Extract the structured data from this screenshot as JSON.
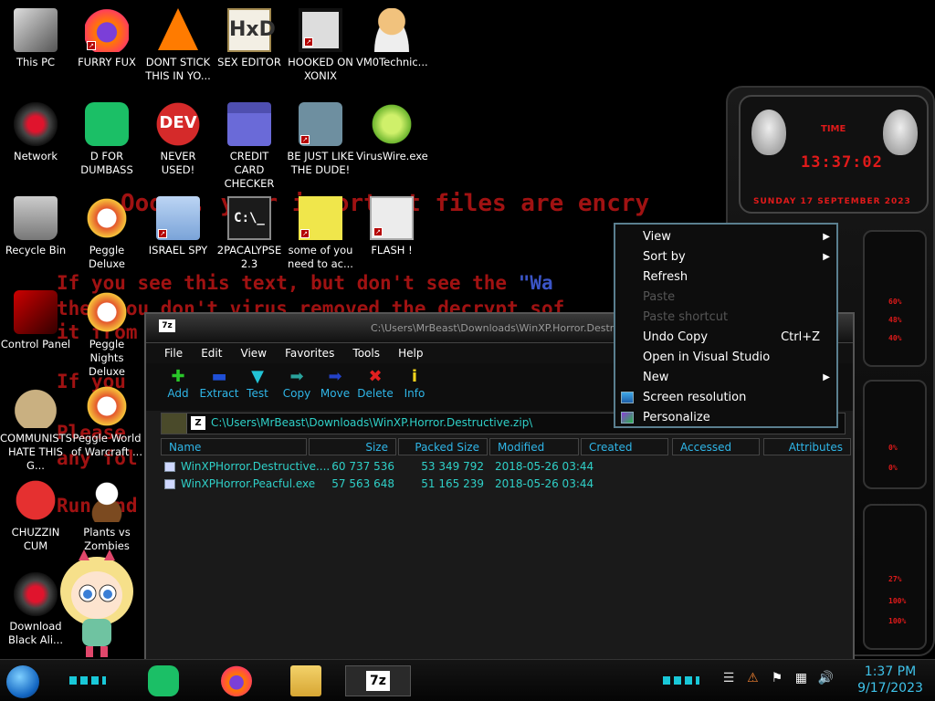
{
  "ransom_note": {
    "line1": "Ooops, your important files are encry",
    "line2a": "If you see this text, but don't see the ",
    "line2b": "\"Wa",
    "line3": "then you don't virus removed the decrypt sof",
    "line4": "it from",
    "line5": "If you",
    "line6": "Please",
    "line7": "any fol",
    "line8": "Run and"
  },
  "desktop_icons": [
    {
      "label": "This PC",
      "icon": "computer-icon"
    },
    {
      "label": "FURRY FUX",
      "icon": "firefox-like-icon"
    },
    {
      "label": "DONT STICK THIS IN YO...",
      "icon": "vlc-cone-icon"
    },
    {
      "label": "SEX EDITOR",
      "icon": "hxd-icon"
    },
    {
      "label": "HOOKED ON XONIX",
      "icon": "xonix-icon"
    },
    {
      "label": "VM0Technic...",
      "icon": "doctor-icon"
    },
    {
      "label": "Network",
      "icon": "network-icon"
    },
    {
      "label": "D FOR DUMBASS",
      "icon": "green-app-icon"
    },
    {
      "label": "NEVER USED!",
      "icon": "devcpp-icon"
    },
    {
      "label": "CREDIT CARD CHECKER",
      "icon": "credit-card-icon"
    },
    {
      "label": "BE JUST LIKE THE DUDE!",
      "icon": "elf-icon"
    },
    {
      "label": "VirusWire.exe",
      "icon": "lime-icon"
    },
    {
      "label": "Recycle Bin",
      "icon": "recycle-bin-icon"
    },
    {
      "label": "Peggle Deluxe",
      "icon": "peggle-icon"
    },
    {
      "label": "ISRAEL SPY",
      "icon": "spy-icon"
    },
    {
      "label": "2PACALYPSE 2.3",
      "icon": "cmd-icon"
    },
    {
      "label": "some of you need to ac...",
      "icon": "dog-icon"
    },
    {
      "label": "FLASH !",
      "icon": "flash-icon"
    },
    {
      "label": "Control Panel",
      "icon": "control-panel-icon"
    },
    {
      "label": "Peggle Nights Deluxe",
      "icon": "peggle-icon"
    },
    {
      "label": "COMMUNISTS HATE THIS G...",
      "icon": "money-bag-icon"
    },
    {
      "label": "Peggle World of Warcraft ...",
      "icon": "peggle-icon"
    },
    {
      "label": "CHUZZIN CUM",
      "icon": "chuzzle-icon"
    },
    {
      "label": "Plants vs Zombies",
      "icon": "plant-icon"
    },
    {
      "label": "Download Black Ali...",
      "icon": "alienware-icon"
    }
  ],
  "gadget": {
    "time_label": "TIME",
    "time": "13:37:02",
    "date": "SUNDAY 17 SEPTEMBER 2023",
    "pct": [
      "60%",
      "48%",
      "40%",
      "0%",
      "0%",
      "27%",
      "100%",
      "100%"
    ]
  },
  "sevenzip": {
    "title": "C:\\Users\\MrBeast\\Downloads\\WinXP.Horror.Destructive.zip\\",
    "menu": [
      "File",
      "Edit",
      "View",
      "Favorites",
      "Tools",
      "Help"
    ],
    "toolbar": [
      {
        "label": "Add",
        "icon": "add-plus-icon",
        "color": "#29c629",
        "glyph": "✚"
      },
      {
        "label": "Extract",
        "icon": "extract-minus-icon",
        "color": "#1f4fd6",
        "glyph": "▬"
      },
      {
        "label": "Test",
        "icon": "test-check-icon",
        "color": "#22c3d6",
        "glyph": "▼"
      },
      {
        "label": "Copy",
        "icon": "copy-arrow-icon",
        "color": "#2aa39c",
        "glyph": "➡"
      },
      {
        "label": "Move",
        "icon": "move-arrow-icon",
        "color": "#2442c8",
        "glyph": "➡"
      },
      {
        "label": "Delete",
        "icon": "delete-x-icon",
        "color": "#e02020",
        "glyph": "✖"
      },
      {
        "label": "Info",
        "icon": "info-icon",
        "color": "#f1d21c",
        "glyph": "i"
      }
    ],
    "address": "C:\\Users\\MrBeast\\Downloads\\WinXP.Horror.Destructive.zip\\",
    "columns": [
      "Name",
      "Size",
      "Packed Size",
      "Modified",
      "Created",
      "Accessed",
      "Attributes"
    ],
    "rows": [
      {
        "name": "WinXPHorror.Destructive....",
        "size": "60 737 536",
        "packed": "53 349 792",
        "modified": "2018-05-26 03:44"
      },
      {
        "name": "WinXPHorror.Peacful.exe",
        "size": "57 563 648",
        "packed": "51 165 239",
        "modified": "2018-05-26 03:44"
      }
    ]
  },
  "context_menu": [
    {
      "label": "View",
      "arrow": true
    },
    {
      "label": "Sort by",
      "arrow": true
    },
    {
      "label": "Refresh"
    },
    {
      "label": "Paste",
      "disabled": true
    },
    {
      "label": "Paste shortcut",
      "disabled": true
    },
    {
      "label": "Undo Copy",
      "shortcut": "Ctrl+Z"
    },
    {
      "label": "Open in Visual Studio"
    },
    {
      "label": "New",
      "arrow": true
    },
    {
      "label": "Screen resolution",
      "icon": "display-icon"
    },
    {
      "label": "Personalize",
      "icon": "personalize-icon"
    }
  ],
  "taskbar": {
    "time": "1:37 PM",
    "date": "9/17/2023",
    "tray": [
      "warning-icon",
      "flag-icon",
      "network-icon",
      "volume-icon"
    ]
  }
}
